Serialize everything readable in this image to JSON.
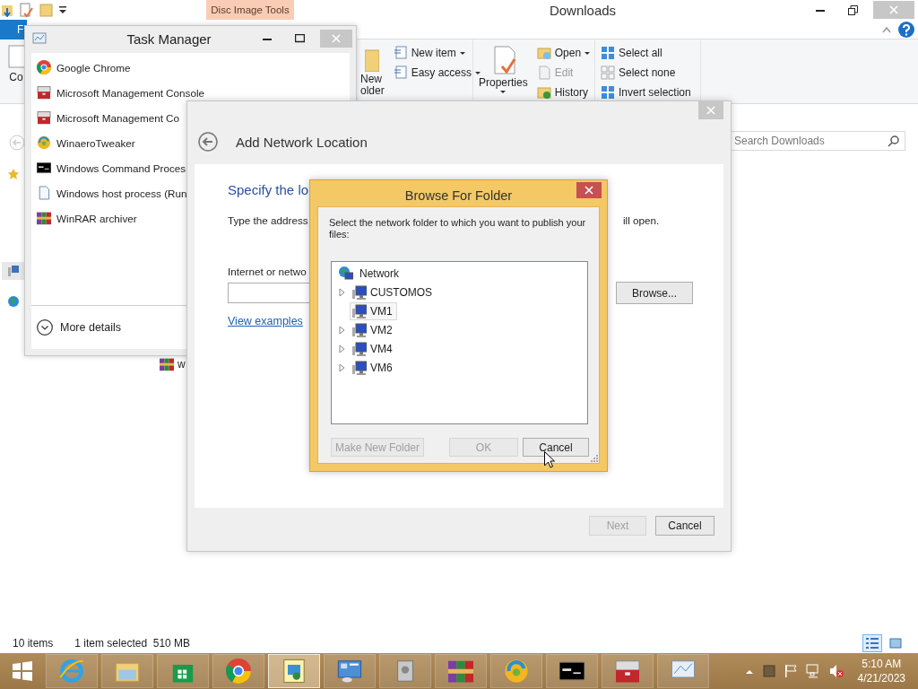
{
  "explorer": {
    "title": "Downloads",
    "context_tab": "Disc Image Tools",
    "file_tab": "F",
    "ribbon": {
      "clipboard_label": "Co",
      "new_folder_lines": [
        "New",
        "older"
      ],
      "new_items": [
        {
          "label": "New item",
          "dropdown": true
        },
        {
          "label": "Easy access",
          "dropdown": true
        }
      ],
      "properties": "Properties",
      "open_items": [
        {
          "label": "Open",
          "disabled": false,
          "dropdown": true
        },
        {
          "label": "Edit",
          "disabled": true,
          "dropdown": false
        },
        {
          "label": "History",
          "disabled": false,
          "dropdown": false
        }
      ],
      "select_items": [
        "Select all",
        "Select none",
        "Invert selection"
      ]
    },
    "search": {
      "placeholder": "Search Downloads"
    },
    "file_row": {
      "name": "w"
    },
    "status": {
      "count": "10 items",
      "selection": "1 item selected  510 MB"
    }
  },
  "task_manager": {
    "title": "Task Manager",
    "apps": [
      {
        "kind": "chrome",
        "name": "Google Chrome"
      },
      {
        "kind": "toolbox",
        "name": "Microsoft Management Console"
      },
      {
        "kind": "toolbox",
        "name": "Microsoft Management Co"
      },
      {
        "kind": "swirl",
        "name": "WinaeroTweaker"
      },
      {
        "kind": "terminal",
        "name": "Windows Command Proces"
      },
      {
        "kind": "document",
        "name": "Windows host process (Run"
      },
      {
        "kind": "books",
        "name": "WinRAR archiver"
      }
    ],
    "more_details": "More details"
  },
  "add_network_location": {
    "title": "Add Network Location",
    "heading": "Specify the lo",
    "instruction": "Type the address",
    "instruction_end": "ill open.",
    "field_label": "Internet or netwo",
    "browse": "Browse...",
    "link": "View examples",
    "buttons": [
      {
        "label": "Next",
        "disabled": true
      },
      {
        "label": "Cancel",
        "disabled": false
      }
    ]
  },
  "browse_for_folder": {
    "title": "Browse For Folder",
    "prompt": "Select the network folder to which you want to publish your files:",
    "tree": {
      "label": "Network",
      "children": [
        {
          "label": "CUSTOMOS",
          "expandable": true,
          "selected": false
        },
        {
          "label": "VM1",
          "expandable": false,
          "selected": true
        },
        {
          "label": "VM2",
          "expandable": true,
          "selected": false
        },
        {
          "label": "VM4",
          "expandable": true,
          "selected": false
        },
        {
          "label": "VM6",
          "expandable": true,
          "selected": false
        }
      ]
    },
    "buttons": [
      {
        "label": "Make New Folder",
        "disabled": true
      },
      {
        "label": "OK",
        "disabled": true
      },
      {
        "label": "Cancel",
        "disabled": false
      }
    ]
  },
  "taskbar": {
    "apps": [
      {
        "kind": "ie",
        "selected": false
      },
      {
        "kind": "folder",
        "selected": false
      },
      {
        "kind": "store",
        "selected": false
      },
      {
        "kind": "chrome",
        "selected": false
      },
      {
        "kind": "network",
        "selected": true
      },
      {
        "kind": "panel",
        "selected": false
      },
      {
        "kind": "drive",
        "selected": false
      },
      {
        "kind": "books",
        "selected": false
      },
      {
        "kind": "swirl",
        "selected": false
      },
      {
        "kind": "terminal",
        "selected": false
      },
      {
        "kind": "toolbox",
        "selected": false
      },
      {
        "kind": "monitor",
        "selected": false
      }
    ],
    "time": "5:10 AM",
    "date": "4/21/2023"
  }
}
